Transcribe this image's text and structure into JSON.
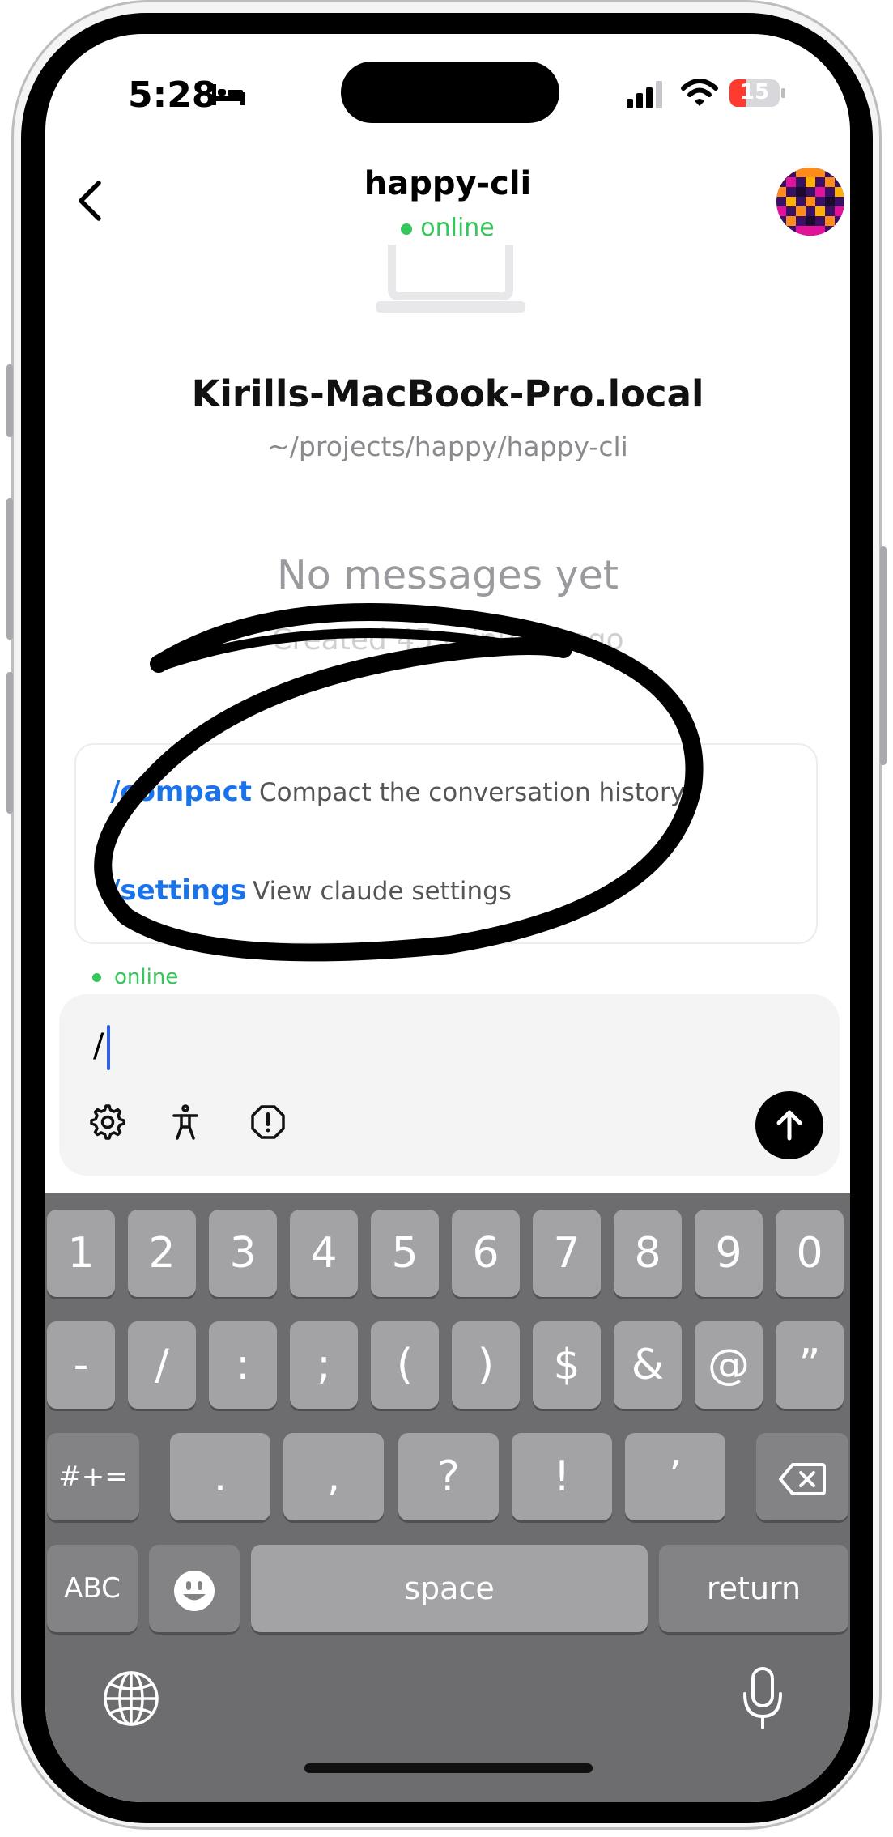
{
  "status_bar": {
    "time": "5:28",
    "battery": "15"
  },
  "header": {
    "title": "happy-cli",
    "status": "online"
  },
  "session": {
    "machine": "Kirills-MacBook-Pro.local",
    "path": "~/projects/happy/happy-cli",
    "empty_title": "No messages yet",
    "created": "Created 45 minutes ago"
  },
  "commands": [
    {
      "name": "/compact",
      "description": "Compact the conversation history"
    },
    {
      "name": "/settings",
      "description": "View claude settings"
    }
  ],
  "composer": {
    "status": "online",
    "value": "/"
  },
  "keyboard": {
    "row1": [
      "1",
      "2",
      "3",
      "4",
      "5",
      "6",
      "7",
      "8",
      "9",
      "0"
    ],
    "row2": [
      "-",
      "/",
      ":",
      ";",
      "(",
      ")",
      "$",
      "&",
      "@",
      "”"
    ],
    "row3": [
      "#+=",
      ".",
      ",",
      "?",
      "!",
      "’"
    ],
    "row4": [
      "ABC",
      "space",
      "return"
    ]
  },
  "colors": {
    "accent": "#1a73e8",
    "online": "#34c759",
    "caret": "#2f5ee8"
  }
}
